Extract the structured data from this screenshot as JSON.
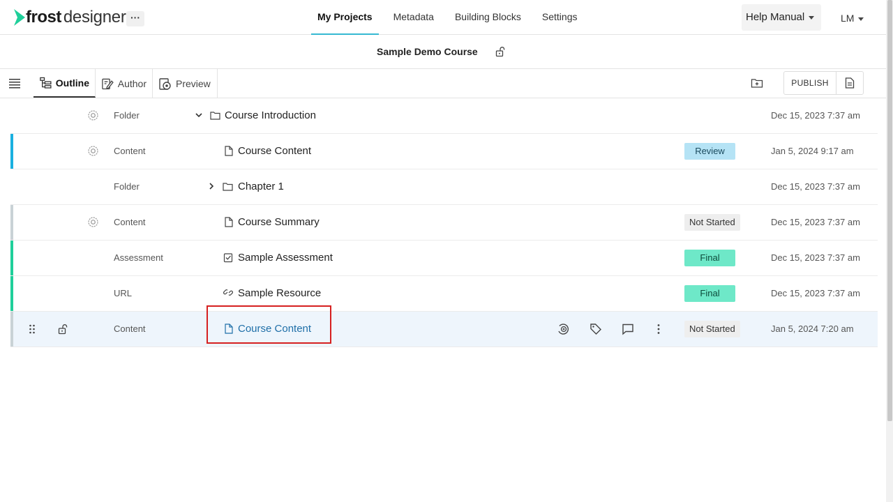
{
  "app": {
    "logo_main": "frost",
    "logo_sub": "designer",
    "more_label": "···",
    "nav_tabs": [
      {
        "label": "My Projects",
        "active": true
      },
      {
        "label": "Metadata",
        "active": false
      },
      {
        "label": "Building Blocks",
        "active": false
      },
      {
        "label": "Settings",
        "active": false
      }
    ],
    "help_label": "Help Manual",
    "user_initials": "LM"
  },
  "course": {
    "title": "Sample Demo Course",
    "lock_icon": "unlock-icon"
  },
  "toolbar": {
    "views": [
      {
        "label": "Outline",
        "icon": "outline-icon",
        "active": true
      },
      {
        "label": "Author",
        "icon": "author-icon",
        "active": false
      },
      {
        "label": "Preview",
        "icon": "preview-icon",
        "active": false
      }
    ],
    "publish_label": "PUBLISH"
  },
  "rows": [
    {
      "type": "Folder",
      "name": "Course Introduction",
      "date": "Dec 15, 2023 7:37 am",
      "status": "",
      "expanded": true
    },
    {
      "type": "Content",
      "name": "Course Content",
      "date": "Jan 5, 2024 9:17 am",
      "status": "Review"
    },
    {
      "type": "Folder",
      "name": "Chapter 1",
      "date": "Dec 15, 2023 7:37 am",
      "status": "",
      "expanded": false
    },
    {
      "type": "Content",
      "name": "Course Summary",
      "date": "Dec 15, 2023 7:37 am",
      "status": "Not Started"
    },
    {
      "type": "Assessment",
      "name": "Sample Assessment",
      "date": "Dec 15, 2023 7:37 am",
      "status": "Final"
    },
    {
      "type": "URL",
      "name": "Sample Resource",
      "date": "Dec 15, 2023 7:37 am",
      "status": "Final"
    },
    {
      "type": "Content",
      "name": "Course Content",
      "date": "Jan 5, 2024 7:20 am",
      "status": "Not Started",
      "selected": true
    }
  ],
  "colors": {
    "accent": "#35b9d2",
    "bar_blue": "#1ab0e0",
    "bar_green": "#1fcf9a",
    "bar_gray": "#c9d2d6",
    "highlight": "#d62020"
  }
}
